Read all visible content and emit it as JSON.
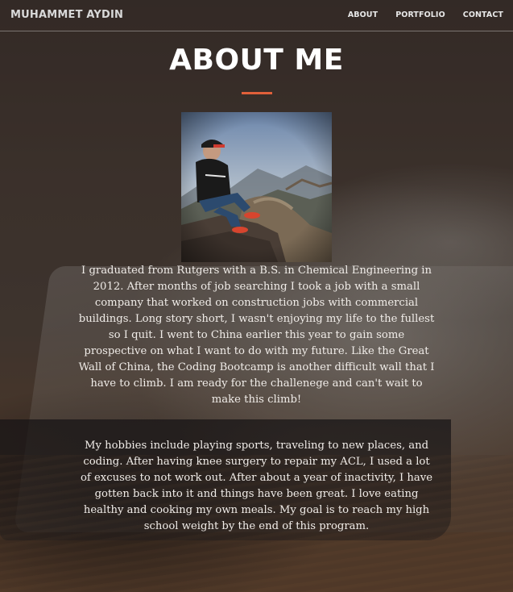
{
  "navbar": {
    "brand": "MUHAMMET AYDIN",
    "links": [
      {
        "label": "ABOUT"
      },
      {
        "label": "PORTFOLIO"
      },
      {
        "label": "CONTACT"
      }
    ]
  },
  "main": {
    "title": "ABOUT ME",
    "accent_color": "#e0603a",
    "paragraphs": [
      "I graduated from Rutgers with a B.S. in Chemical Engineering in 2012. After months of job searching I took a job with a small company that worked on construction jobs with commercial buildings. Long story short, I wasn't enjoying my life to the fullest so I quit. I went to China earlier this year to gain some prospective on what I want to do with my future. Like the Great Wall of China, the Coding Bootcamp is another difficult wall that I have to climb. I am ready for the challenege and can't wait to make this climb!",
      "My hobbies include playing sports, traveling to new places, and coding. After having knee surgery to repair my ACL, I used a lot of excuses to not work out. After about a year of inactivity, I have gotten back into it and things have been great. I love eating healthy and cooking my own meals. My goal is to reach my high school weight by the end of this program."
    ]
  }
}
